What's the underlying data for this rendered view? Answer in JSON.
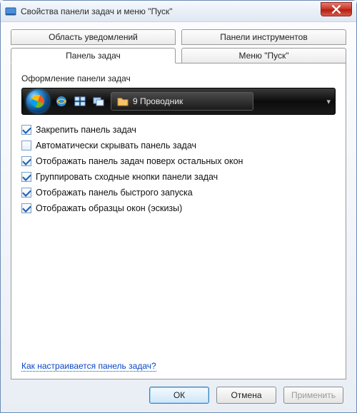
{
  "window": {
    "title": "Свойства панели задач и меню \"Пуск\""
  },
  "tabs": {
    "notification": "Область уведомлений",
    "toolbars": "Панели инструментов",
    "taskbar": "Панель задач",
    "startmenu": "Меню \"Пуск\""
  },
  "group": {
    "appearance_label": "Оформление панели задач"
  },
  "preview": {
    "task_label": "9 Проводник"
  },
  "options": {
    "lock": {
      "label": "Закрепить панель задач",
      "checked": true
    },
    "autohide": {
      "label": "Автоматически скрывать панель задач",
      "checked": false
    },
    "ontop": {
      "label": "Отображать панель задач поверх остальных окон",
      "checked": true
    },
    "group": {
      "label": "Группировать сходные кнопки панели задач",
      "checked": true
    },
    "quicklaunch": {
      "label": "Отображать панель быстрого запуска",
      "checked": true
    },
    "thumbnails": {
      "label": "Отображать образцы окон (эскизы)",
      "checked": true
    }
  },
  "help_link": "Как настраивается панель задач?",
  "buttons": {
    "ok": "ОК",
    "cancel": "Отмена",
    "apply": "Применить"
  }
}
